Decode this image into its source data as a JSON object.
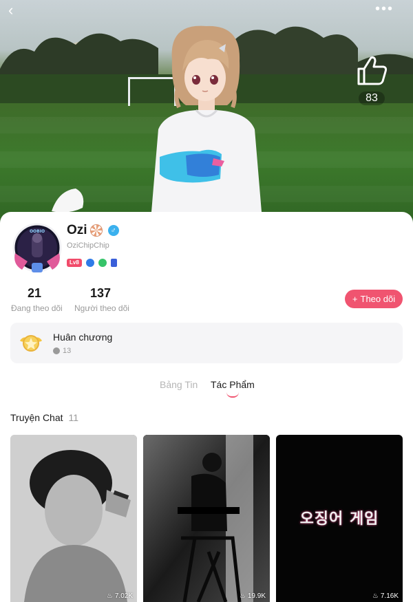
{
  "header": {
    "like_count": "83"
  },
  "profile": {
    "username": "Ozi",
    "handle": "OziChipChip",
    "level_badge": "Lv8",
    "gender_symbol": "♂",
    "avatar_text": "OOBIO"
  },
  "stats": {
    "following_count": "21",
    "following_label": "Đang theo dõi",
    "followers_count": "137",
    "followers_label": "Người theo dõi"
  },
  "follow_button": {
    "icon": "+",
    "label": "Theo dõi"
  },
  "medal": {
    "title": "Huân chương",
    "count": "13"
  },
  "tabs": [
    {
      "label": "Bảng Tin",
      "active": false
    },
    {
      "label": "Tác Phẩm",
      "active": true
    }
  ],
  "section": {
    "title": "Truyện Chat",
    "count": "11"
  },
  "stories": [
    {
      "views": "7.02K",
      "overlay_text": ""
    },
    {
      "views": "19.9K",
      "overlay_text": ""
    },
    {
      "views": "7.16K",
      "overlay_text": "오징어 게임"
    }
  ],
  "colors": {
    "accent": "#f05470",
    "muted": "#9a9a9a",
    "panel": "#f5f5f7"
  }
}
